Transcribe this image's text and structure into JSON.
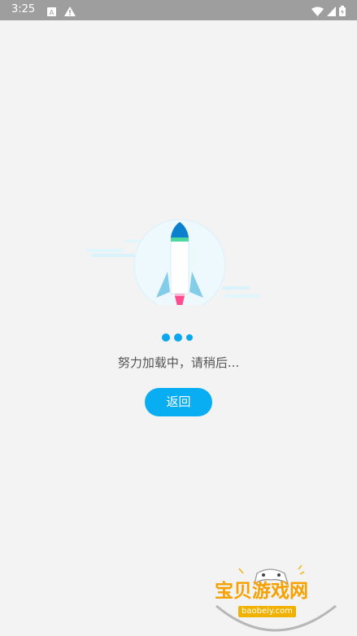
{
  "status_bar": {
    "time": "3:25",
    "left_icons": [
      "a-notification-icon",
      "warning-icon"
    ],
    "right_icons": [
      "wifi-icon",
      "signal-icon",
      "battery-icon"
    ]
  },
  "loading": {
    "message": "努力加载中，请稍后...",
    "back_button_label": "返回"
  },
  "watermark": {
    "title": "宝贝游戏网",
    "url": "baobeiy.com"
  },
  "colors": {
    "background": "#f3f3f3",
    "status_bar": "#9e9e9e",
    "accent": "#09aef2"
  }
}
